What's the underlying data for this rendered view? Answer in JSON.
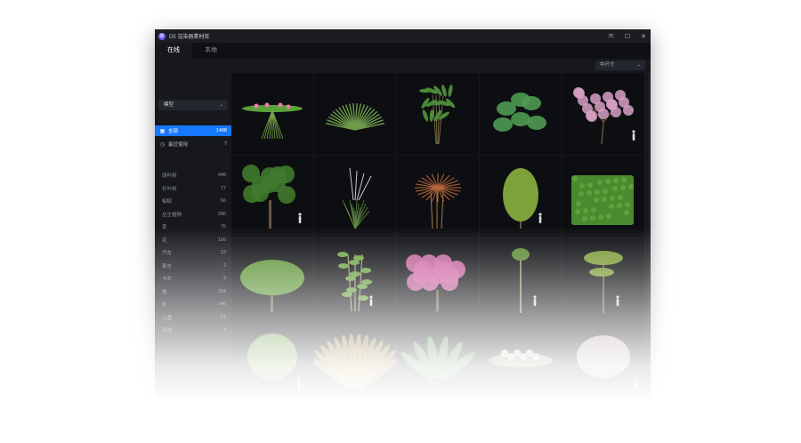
{
  "window": {
    "title": "D5 渲染器素材库",
    "logo_letter": "D"
  },
  "controls": {
    "pin": "⇱",
    "maximize": "☐",
    "close": "✕"
  },
  "tabs": [
    {
      "label": "在线"
    },
    {
      "label": "本地"
    }
  ],
  "toolbar": {
    "size_select": "中尺寸"
  },
  "sidebar": {
    "category_select": "模型",
    "nav": [
      {
        "label": "全部",
        "count": "1488"
      },
      {
        "label": "最近使用",
        "count": "7"
      }
    ],
    "categories": [
      {
        "label": "阔叶树",
        "count": "448"
      },
      {
        "label": "针叶树",
        "count": "77"
      },
      {
        "label": "棕榈",
        "count": "66"
      },
      {
        "label": "丛生植物",
        "count": "286"
      },
      {
        "label": "草",
        "count": "76"
      },
      {
        "label": "花",
        "count": "166"
      },
      {
        "label": "汽车",
        "count": "23"
      },
      {
        "label": "客车",
        "count": "2"
      },
      {
        "label": "卡车",
        "count": "3"
      },
      {
        "label": "男",
        "count": "154"
      },
      {
        "label": "女",
        "count": "146"
      },
      {
        "label": "儿童",
        "count": "21"
      },
      {
        "label": "其他",
        "count": "4"
      }
    ]
  },
  "assets": [
    {
      "icon": "water-lily-icon",
      "leaf": "#5aa33a",
      "accent": "#f07ab0"
    },
    {
      "icon": "agave-icon",
      "leaf": "#6d9b4a",
      "accent": "#6d9b4a"
    },
    {
      "icon": "palm-plant-icon",
      "leaf": "#4b8a38",
      "accent": "#4b8a38"
    },
    {
      "icon": "monstera-icon",
      "leaf": "#4f9a52",
      "accent": "#4f9a52"
    },
    {
      "icon": "pink-blossom-tree-icon",
      "leaf": "#d7a0c4",
      "accent": "#d7a0c4"
    },
    {
      "icon": "broadleaf-tree-icon",
      "leaf": "#3f7a2c",
      "accent": "#3f7a2c"
    },
    {
      "icon": "grass-plume-icon",
      "leaf": "#5e8a3e",
      "accent": "#c9c9c9"
    },
    {
      "icon": "cordyline-icon",
      "leaf": "#b8653a",
      "accent": "#b8653a"
    },
    {
      "icon": "conifer-tree-icon",
      "leaf": "#7da23a",
      "accent": "#7da23a"
    },
    {
      "icon": "hedge-icon",
      "leaf": "#4a8a2e",
      "accent": "#4a8a2e"
    },
    {
      "icon": "round-tree-icon",
      "leaf": "#5d9435",
      "accent": "#5d9435"
    },
    {
      "icon": "bamboo-icon",
      "leaf": "#6aa040",
      "accent": "#6aa040"
    },
    {
      "icon": "magenta-flower-tree-icon",
      "leaf": "#d06aa8",
      "accent": "#d06aa8"
    },
    {
      "icon": "tall-thin-tree-icon",
      "leaf": "#5a8a35",
      "accent": "#5a8a35"
    },
    {
      "icon": "acacia-tree-icon",
      "leaf": "#7a9a35",
      "accent": "#7a9a35"
    },
    {
      "icon": "bushy-tree-icon",
      "leaf": "#6a9a40",
      "accent": "#6a9a40"
    },
    {
      "icon": "golden-plant-icon",
      "leaf": "#c8a040",
      "accent": "#c8a040"
    },
    {
      "icon": "tropical-plant-icon",
      "leaf": "#5a9a55",
      "accent": "#5a9a55"
    },
    {
      "icon": "white-flower-shrub-icon",
      "leaf": "#c8d0c8",
      "accent": "#c8d0c8"
    },
    {
      "icon": "fluffy-tree-icon",
      "leaf": "#b0a0b0",
      "accent": "#b0a0b0"
    }
  ]
}
